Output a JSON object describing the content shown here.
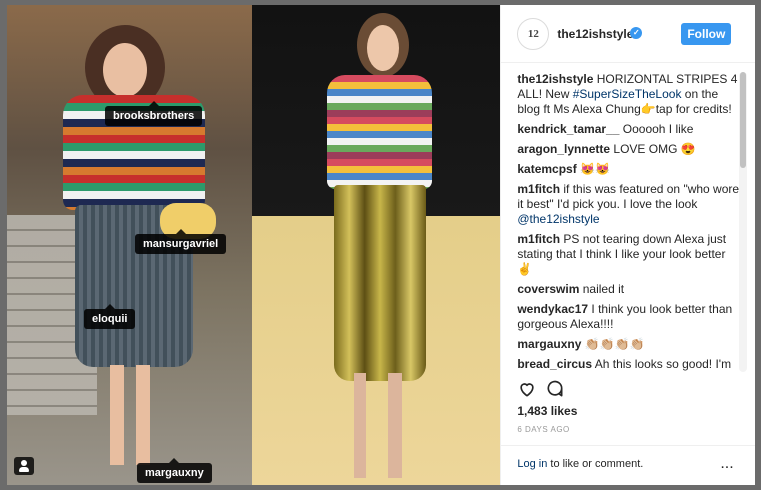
{
  "post": {
    "tags": [
      "brooksbrothers",
      "mansurgavriel",
      "eloquii",
      "margauxny"
    ],
    "header": {
      "username": "the12ishstyle",
      "follow": "Follow"
    },
    "caption": {
      "username": "the12ishstyle",
      "text": "HORIZONTAL STRIPES 4 ALL! New ",
      "hashtag": "#SuperSizeTheLook",
      "text2": " on the blog ft Ms Alexa Chung👉tap for credits!"
    },
    "comments": [
      {
        "user": "kendrick_tamar__",
        "text": "Oooooh I like"
      },
      {
        "user": "aragon_lynnette",
        "text": "LOVE OMG 😍"
      },
      {
        "user": "katemcpsf",
        "text": "😻😻"
      },
      {
        "user": "m1fitch",
        "text": "if this was featured on \"who wore it best\" I'd pick you. I love the look ",
        "mention": "@the12ishstyle"
      },
      {
        "user": "m1fitch",
        "text": "PS not tearing down Alexa just stating that I think I like your look better ✌️"
      },
      {
        "user": "coverswim",
        "text": "nailed it"
      },
      {
        "user": "wendykac17",
        "text": "I think you look better than gorgeous Alexa!!!!"
      },
      {
        "user": "margauxny",
        "text": "👏🏼👏🏼👏🏼👏🏼"
      },
      {
        "user": "bread_circus",
        "text": "Ah this looks so good! I'm so frustrated though - I bought two"
      }
    ],
    "likes": "1,483 likes",
    "time": "6 DAYS AGO",
    "footer": {
      "login": "Log in",
      "rest": " to like or comment.",
      "more": "..."
    },
    "icons": [
      "heart-icon",
      "comment-icon",
      "user-tag-icon",
      "verified-badge-icon",
      "more-options-icon"
    ]
  }
}
